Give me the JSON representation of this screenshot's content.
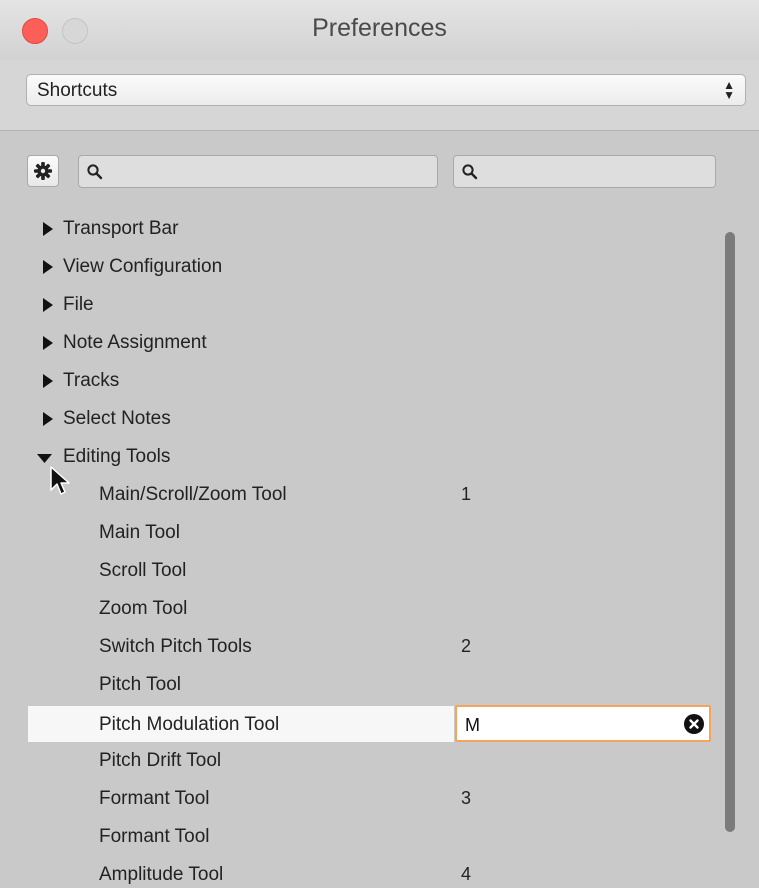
{
  "window": {
    "title": "Preferences"
  },
  "category_select": {
    "value": "Shortcuts"
  },
  "search": {
    "command_query": "",
    "shortcut_query": ""
  },
  "tree": {
    "categories": [
      {
        "label": "Transport Bar",
        "expanded": false
      },
      {
        "label": "View Configuration",
        "expanded": false
      },
      {
        "label": "File",
        "expanded": false
      },
      {
        "label": "Note Assignment",
        "expanded": false
      },
      {
        "label": "Tracks",
        "expanded": false
      },
      {
        "label": "Select Notes",
        "expanded": false
      },
      {
        "label": "Editing Tools",
        "expanded": true
      }
    ],
    "items": [
      {
        "label": "Main/Scroll/Zoom Tool",
        "shortcut": "1"
      },
      {
        "label": "Main Tool",
        "shortcut": ""
      },
      {
        "label": "Scroll Tool",
        "shortcut": ""
      },
      {
        "label": "Zoom Tool",
        "shortcut": ""
      },
      {
        "label": "Switch Pitch Tools",
        "shortcut": "2"
      },
      {
        "label": "Pitch Tool",
        "shortcut": ""
      },
      {
        "label": "Pitch Modulation Tool",
        "shortcut": "M"
      },
      {
        "label": "Pitch Drift Tool",
        "shortcut": ""
      },
      {
        "label": "Formant Tool",
        "shortcut": "3"
      },
      {
        "label": "Formant Tool",
        "shortcut": ""
      },
      {
        "label": "Amplitude Tool",
        "shortcut": "4"
      }
    ]
  },
  "colors": {
    "close_button": "#fc5f57",
    "edit_focus_ring": "#f5a45c",
    "background": "#c9c9c9"
  }
}
